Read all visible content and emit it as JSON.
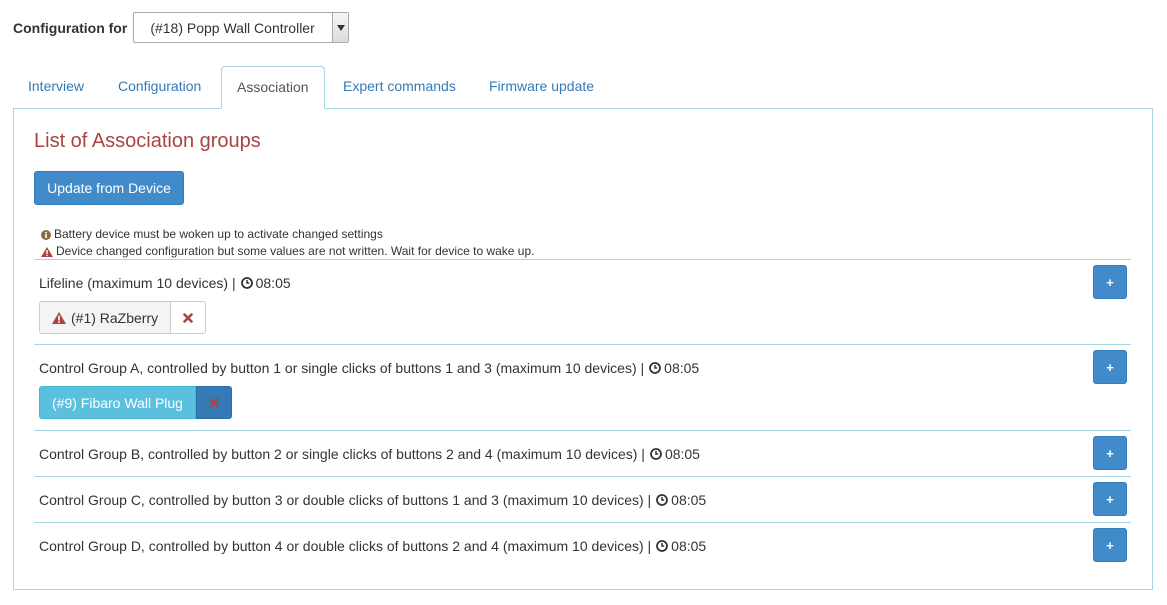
{
  "config": {
    "label": "Configuration for",
    "selected_device": "(#18) Popp Wall Controller"
  },
  "tabs": [
    {
      "label": "Interview",
      "active": false
    },
    {
      "label": "Configuration",
      "active": false
    },
    {
      "label": "Association",
      "active": true
    },
    {
      "label": "Expert commands",
      "active": false
    },
    {
      "label": "Firmware update",
      "active": false
    }
  ],
  "panel": {
    "title": "List of Association groups",
    "update_button": "Update from Device",
    "notes": [
      {
        "icon": "info-circle-icon",
        "text": "Battery device must be woken up to activate changed settings"
      },
      {
        "icon": "warning-icon",
        "text": "Device changed configuration but some values are not written. Wait for device to wake up."
      }
    ]
  },
  "groups": [
    {
      "name": "Lifeline (maximum 10 devices) |",
      "time": "08:05",
      "add_label": "+",
      "members": [
        {
          "label": "(#1) RaZberry",
          "style": "default",
          "warning": true
        }
      ]
    },
    {
      "name": "Control Group A, controlled by button 1 or single clicks of buttons 1 and 3 (maximum 10 devices) |",
      "time": "08:05",
      "add_label": "+",
      "members": [
        {
          "label": "(#9) Fibaro Wall Plug",
          "style": "info",
          "warning": false
        }
      ]
    },
    {
      "name": "Control Group B, controlled by button 2 or single clicks of buttons 2 and 4 (maximum 10 devices) |",
      "time": "08:05",
      "add_label": "+",
      "members": []
    },
    {
      "name": "Control Group C, controlled by button 3 or double clicks of buttons 1 and 3 (maximum 10 devices) |",
      "time": "08:05",
      "add_label": "+",
      "members": []
    },
    {
      "name": "Control Group D, controlled by button 4 or double clicks of buttons 2 and 4 (maximum 10 devices) |",
      "time": "08:05",
      "add_label": "+",
      "members": []
    }
  ],
  "colors": {
    "link": "#337ab7",
    "primary": "#428bca",
    "title_red": "#a94442",
    "warning_red": "#a94442",
    "chip_info": "#5bc0de",
    "border": "#a7d7e0"
  }
}
